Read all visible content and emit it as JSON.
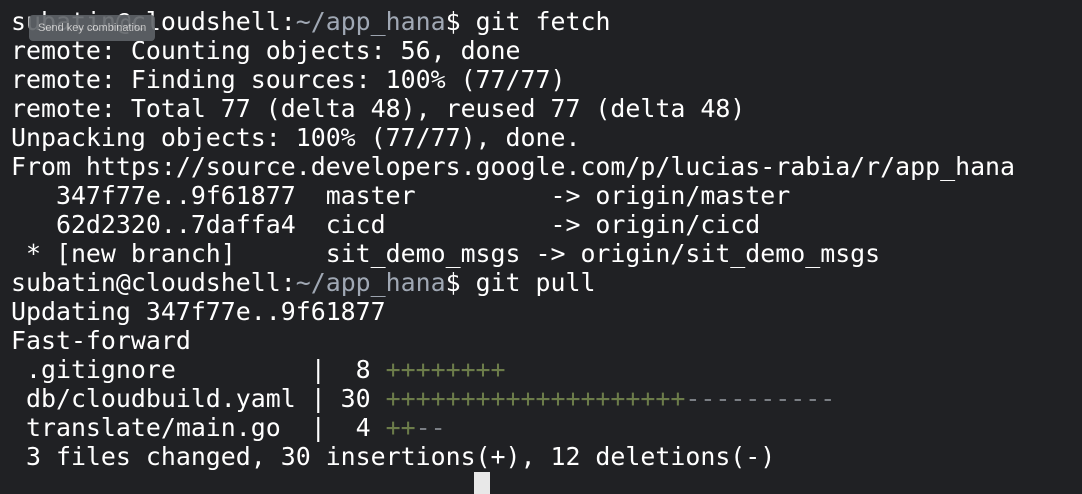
{
  "tooltip": "Send key combination",
  "prompt": {
    "user_host": "subatin@cloudshell:",
    "path": "~/app_hana",
    "suffix": "$ "
  },
  "commands": {
    "fetch": "git fetch",
    "pull": "git pull"
  },
  "output": {
    "l1": "remote: Counting objects: 56, done",
    "l2": "remote: Finding sources: 100% (77/77)",
    "l3": "remote: Total 77 (delta 48), reused 77 (delta 48)",
    "l4": "Unpacking objects: 100% (77/77), done.",
    "l5": "From https://source.developers.google.com/p/lucias-rabia/r/app_hana",
    "l6": "   347f77e..9f61877  master         -> origin/master",
    "l7": "   62d2320..7daffa4  cicd           -> origin/cicd",
    "l8": " * [new branch]      sit_demo_msgs -> origin/sit_demo_msgs",
    "l10": "Updating 347f77e..9f61877",
    "l11": "Fast-forward"
  },
  "diffstat": [
    {
      "file": " .gitignore         |  8 ",
      "plus": "++++++++",
      "minus": ""
    },
    {
      "file": " db/cloudbuild.yaml | 30 ",
      "plus": "++++++++++++++++++++",
      "minus": "----------"
    },
    {
      "file": " translate/main.go  |  4 ",
      "plus": "++",
      "minus": "--"
    }
  ],
  "summary": " 3 files changed, 30 insertions(+), 12 deletions(-)"
}
